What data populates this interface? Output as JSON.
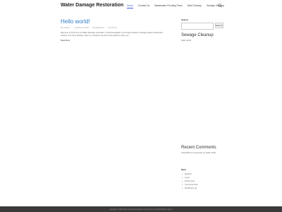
{
  "header": {
    "site_title": "Water Damage Restoration",
    "nav": [
      "Home",
      "Contact Us",
      "Wastewater Flooding Fixes",
      "Mold Cleanup",
      "Sewage Cleanup"
    ]
  },
  "post": {
    "title": "Hello world!",
    "author": "By website...",
    "date": "January 15, 2023",
    "category": "Uncategorized",
    "comments": "1 Comment",
    "excerpt": "Welcome to Anytrust LLC Water Damage restoration, mold Remediation, and Carpet Cleaner/ Sewage washer, Biohazard cleanup. For every disaster. there is a solutions we know how painful is when you ...",
    "read_more": "Read More"
  },
  "sidebar": {
    "search_label": "Search",
    "search_placeholder": "",
    "search_button": "Search",
    "widget_title": "Sewage Cleanup",
    "widget_text": "Hello world!"
  },
  "recent_comments": {
    "title": "Recent Comments",
    "text": "A WordPress Commenter on Hello world!"
  },
  "meta": {
    "title": "Meta",
    "items": [
      "Register",
      "Log in",
      "Entries feed",
      "Comments feed",
      "WordPress.org"
    ]
  },
  "footer": {
    "text": "Copyright © 2023 Water Damage Restoration | Powered by Astra WordPress Theme"
  }
}
